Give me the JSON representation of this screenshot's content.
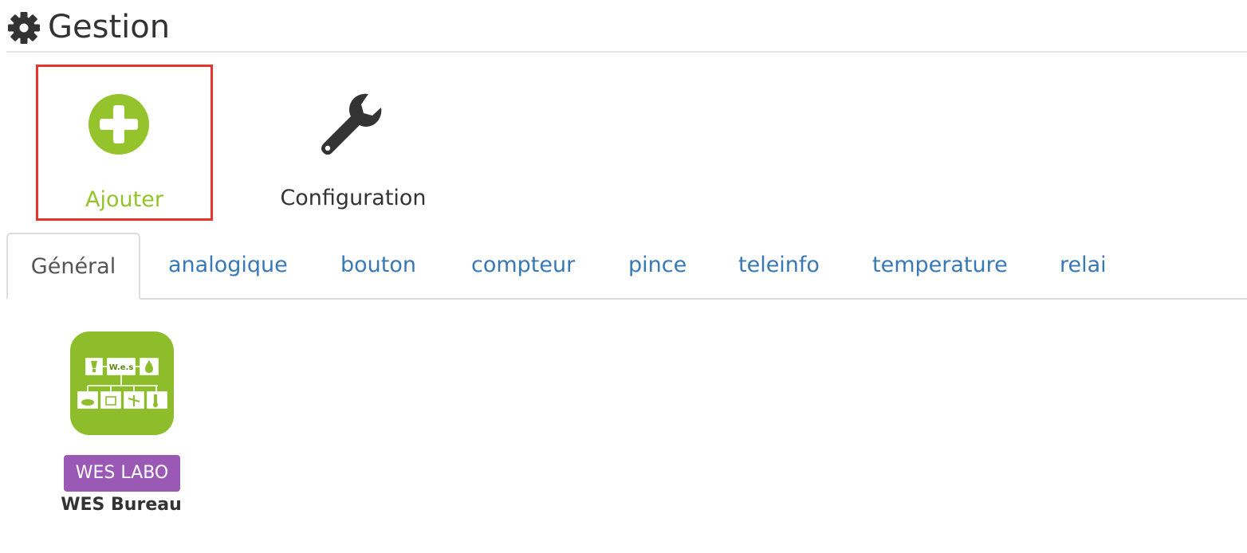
{
  "legend": {
    "title": "Gestion",
    "icon": "gear-icon"
  },
  "actions": {
    "add_label": "Ajouter",
    "add_icon": "plus-circle-icon",
    "add_color": "#94c32b",
    "config_label": "Configuration",
    "config_icon": "wrench-icon",
    "highlight_color": "#e8332a"
  },
  "tabs": [
    {
      "label": "Général",
      "active": true
    },
    {
      "label": "analogique",
      "active": false
    },
    {
      "label": "bouton",
      "active": false
    },
    {
      "label": "compteur",
      "active": false
    },
    {
      "label": "pince",
      "active": false
    },
    {
      "label": "teleinfo",
      "active": false
    },
    {
      "label": "temperature",
      "active": false
    },
    {
      "label": "relai",
      "active": false
    }
  ],
  "tab_link_color": "#3878b5",
  "equipment": [
    {
      "badge": "WES LABO",
      "badge_color": "#9b59b6",
      "name": "WES Bureau",
      "icon": "wes-plugin-logo",
      "logo_text": "W.e.s"
    }
  ]
}
